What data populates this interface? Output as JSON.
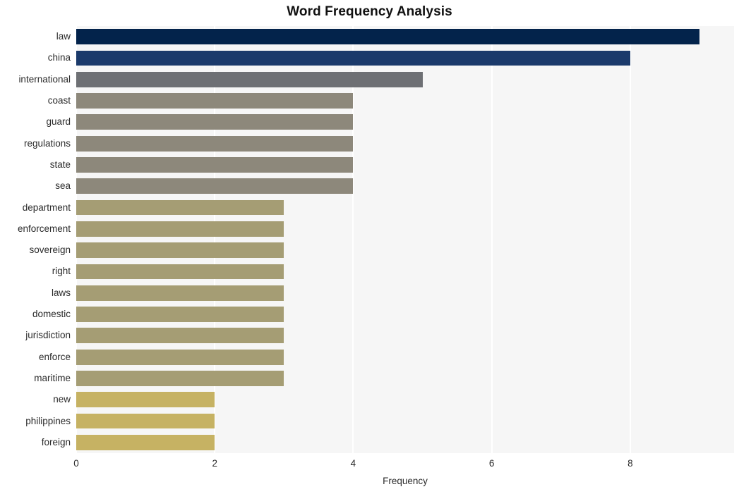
{
  "chart_data": {
    "type": "bar",
    "orientation": "horizontal",
    "title": "Word Frequency Analysis",
    "xlabel": "Frequency",
    "ylabel": "",
    "categories": [
      "law",
      "china",
      "international",
      "coast",
      "guard",
      "regulations",
      "state",
      "sea",
      "department",
      "enforcement",
      "sovereign",
      "right",
      "laws",
      "domestic",
      "jurisdiction",
      "enforce",
      "maritime",
      "new",
      "philippines",
      "foreign"
    ],
    "values": [
      9,
      8,
      5,
      4,
      4,
      4,
      4,
      4,
      3,
      3,
      3,
      3,
      3,
      3,
      3,
      3,
      3,
      2,
      2,
      2
    ],
    "bar_colors": [
      "#03234b",
      "#1b3a6b",
      "#6e7074",
      "#8d887b",
      "#8d887b",
      "#8d887b",
      "#8d887b",
      "#8d887b",
      "#a59d74",
      "#a59d74",
      "#a59d74",
      "#a59d74",
      "#a59d74",
      "#a59d74",
      "#a59d74",
      "#a59d74",
      "#a59d74",
      "#c6b263",
      "#c6b263",
      "#c6b263"
    ],
    "xlim": [
      0,
      9.5
    ],
    "xticks": [
      0,
      2,
      4,
      6,
      8
    ],
    "xtick_labels": [
      "0",
      "2",
      "4",
      "6",
      "8"
    ],
    "grid": true,
    "grid_axis": "x",
    "legend": null,
    "plot_background": "#f6f6f6",
    "figure_background": "#ffffff",
    "gridline_color": "#ffffff"
  }
}
